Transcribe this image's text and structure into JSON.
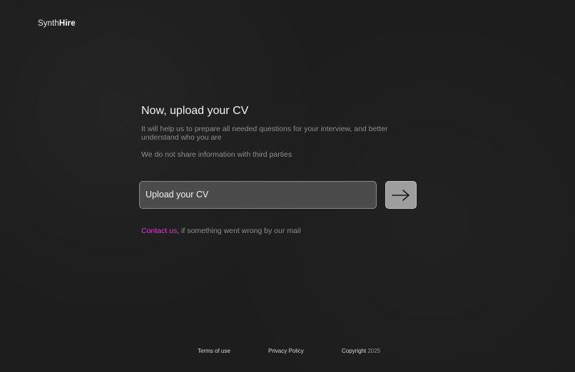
{
  "brand": {
    "name_light": "Synth",
    "name_bold": "Hire"
  },
  "main": {
    "title": "Now, upload your CV",
    "description": "It will help us to prepare all needed questions for your interview, and better understand who you are",
    "privacy_note": "We do not share information with third parties"
  },
  "upload": {
    "placeholder": "Upload your CV",
    "submit_icon": "arrow-right-icon"
  },
  "contact": {
    "link_text": "Contact us",
    "rest_text": ", if something went wrong by our mail"
  },
  "footer": {
    "terms": "Terms of use",
    "privacy": "Privacy Policy",
    "copyright_label": "Copyright",
    "copyright_year": "2025"
  },
  "colors": {
    "background": "#1d1d1d",
    "accent_link": "#d43fcf",
    "field_background": "#4b4b4b",
    "button_background": "#9e9e9e"
  }
}
